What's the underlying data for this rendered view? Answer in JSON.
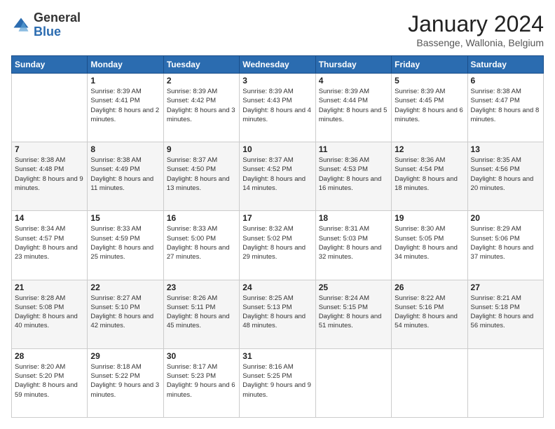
{
  "header": {
    "logo_general": "General",
    "logo_blue": "Blue",
    "month_title": "January 2024",
    "subtitle": "Bassenge, Wallonia, Belgium"
  },
  "days_of_week": [
    "Sunday",
    "Monday",
    "Tuesday",
    "Wednesday",
    "Thursday",
    "Friday",
    "Saturday"
  ],
  "weeks": [
    [
      {
        "day": "",
        "sunrise": "",
        "sunset": "",
        "daylight": ""
      },
      {
        "day": "1",
        "sunrise": "Sunrise: 8:39 AM",
        "sunset": "Sunset: 4:41 PM",
        "daylight": "Daylight: 8 hours and 2 minutes."
      },
      {
        "day": "2",
        "sunrise": "Sunrise: 8:39 AM",
        "sunset": "Sunset: 4:42 PM",
        "daylight": "Daylight: 8 hours and 3 minutes."
      },
      {
        "day": "3",
        "sunrise": "Sunrise: 8:39 AM",
        "sunset": "Sunset: 4:43 PM",
        "daylight": "Daylight: 8 hours and 4 minutes."
      },
      {
        "day": "4",
        "sunrise": "Sunrise: 8:39 AM",
        "sunset": "Sunset: 4:44 PM",
        "daylight": "Daylight: 8 hours and 5 minutes."
      },
      {
        "day": "5",
        "sunrise": "Sunrise: 8:39 AM",
        "sunset": "Sunset: 4:45 PM",
        "daylight": "Daylight: 8 hours and 6 minutes."
      },
      {
        "day": "6",
        "sunrise": "Sunrise: 8:38 AM",
        "sunset": "Sunset: 4:47 PM",
        "daylight": "Daylight: 8 hours and 8 minutes."
      }
    ],
    [
      {
        "day": "7",
        "sunrise": "Sunrise: 8:38 AM",
        "sunset": "Sunset: 4:48 PM",
        "daylight": "Daylight: 8 hours and 9 minutes."
      },
      {
        "day": "8",
        "sunrise": "Sunrise: 8:38 AM",
        "sunset": "Sunset: 4:49 PM",
        "daylight": "Daylight: 8 hours and 11 minutes."
      },
      {
        "day": "9",
        "sunrise": "Sunrise: 8:37 AM",
        "sunset": "Sunset: 4:50 PM",
        "daylight": "Daylight: 8 hours and 13 minutes."
      },
      {
        "day": "10",
        "sunrise": "Sunrise: 8:37 AM",
        "sunset": "Sunset: 4:52 PM",
        "daylight": "Daylight: 8 hours and 14 minutes."
      },
      {
        "day": "11",
        "sunrise": "Sunrise: 8:36 AM",
        "sunset": "Sunset: 4:53 PM",
        "daylight": "Daylight: 8 hours and 16 minutes."
      },
      {
        "day": "12",
        "sunrise": "Sunrise: 8:36 AM",
        "sunset": "Sunset: 4:54 PM",
        "daylight": "Daylight: 8 hours and 18 minutes."
      },
      {
        "day": "13",
        "sunrise": "Sunrise: 8:35 AM",
        "sunset": "Sunset: 4:56 PM",
        "daylight": "Daylight: 8 hours and 20 minutes."
      }
    ],
    [
      {
        "day": "14",
        "sunrise": "Sunrise: 8:34 AM",
        "sunset": "Sunset: 4:57 PM",
        "daylight": "Daylight: 8 hours and 23 minutes."
      },
      {
        "day": "15",
        "sunrise": "Sunrise: 8:33 AM",
        "sunset": "Sunset: 4:59 PM",
        "daylight": "Daylight: 8 hours and 25 minutes."
      },
      {
        "day": "16",
        "sunrise": "Sunrise: 8:33 AM",
        "sunset": "Sunset: 5:00 PM",
        "daylight": "Daylight: 8 hours and 27 minutes."
      },
      {
        "day": "17",
        "sunrise": "Sunrise: 8:32 AM",
        "sunset": "Sunset: 5:02 PM",
        "daylight": "Daylight: 8 hours and 29 minutes."
      },
      {
        "day": "18",
        "sunrise": "Sunrise: 8:31 AM",
        "sunset": "Sunset: 5:03 PM",
        "daylight": "Daylight: 8 hours and 32 minutes."
      },
      {
        "day": "19",
        "sunrise": "Sunrise: 8:30 AM",
        "sunset": "Sunset: 5:05 PM",
        "daylight": "Daylight: 8 hours and 34 minutes."
      },
      {
        "day": "20",
        "sunrise": "Sunrise: 8:29 AM",
        "sunset": "Sunset: 5:06 PM",
        "daylight": "Daylight: 8 hours and 37 minutes."
      }
    ],
    [
      {
        "day": "21",
        "sunrise": "Sunrise: 8:28 AM",
        "sunset": "Sunset: 5:08 PM",
        "daylight": "Daylight: 8 hours and 40 minutes."
      },
      {
        "day": "22",
        "sunrise": "Sunrise: 8:27 AM",
        "sunset": "Sunset: 5:10 PM",
        "daylight": "Daylight: 8 hours and 42 minutes."
      },
      {
        "day": "23",
        "sunrise": "Sunrise: 8:26 AM",
        "sunset": "Sunset: 5:11 PM",
        "daylight": "Daylight: 8 hours and 45 minutes."
      },
      {
        "day": "24",
        "sunrise": "Sunrise: 8:25 AM",
        "sunset": "Sunset: 5:13 PM",
        "daylight": "Daylight: 8 hours and 48 minutes."
      },
      {
        "day": "25",
        "sunrise": "Sunrise: 8:24 AM",
        "sunset": "Sunset: 5:15 PM",
        "daylight": "Daylight: 8 hours and 51 minutes."
      },
      {
        "day": "26",
        "sunrise": "Sunrise: 8:22 AM",
        "sunset": "Sunset: 5:16 PM",
        "daylight": "Daylight: 8 hours and 54 minutes."
      },
      {
        "day": "27",
        "sunrise": "Sunrise: 8:21 AM",
        "sunset": "Sunset: 5:18 PM",
        "daylight": "Daylight: 8 hours and 56 minutes."
      }
    ],
    [
      {
        "day": "28",
        "sunrise": "Sunrise: 8:20 AM",
        "sunset": "Sunset: 5:20 PM",
        "daylight": "Daylight: 8 hours and 59 minutes."
      },
      {
        "day": "29",
        "sunrise": "Sunrise: 8:18 AM",
        "sunset": "Sunset: 5:22 PM",
        "daylight": "Daylight: 9 hours and 3 minutes."
      },
      {
        "day": "30",
        "sunrise": "Sunrise: 8:17 AM",
        "sunset": "Sunset: 5:23 PM",
        "daylight": "Daylight: 9 hours and 6 minutes."
      },
      {
        "day": "31",
        "sunrise": "Sunrise: 8:16 AM",
        "sunset": "Sunset: 5:25 PM",
        "daylight": "Daylight: 9 hours and 9 minutes."
      },
      {
        "day": "",
        "sunrise": "",
        "sunset": "",
        "daylight": ""
      },
      {
        "day": "",
        "sunrise": "",
        "sunset": "",
        "daylight": ""
      },
      {
        "day": "",
        "sunrise": "",
        "sunset": "",
        "daylight": ""
      }
    ]
  ]
}
